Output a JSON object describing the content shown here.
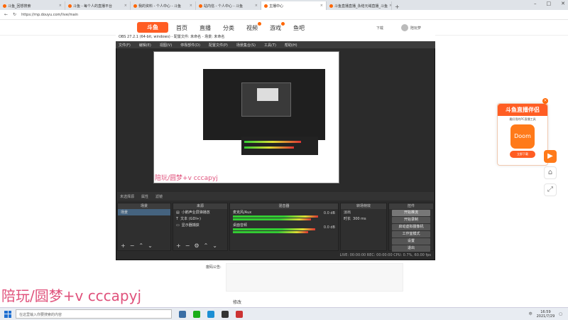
{
  "browser": {
    "tabs": [
      "斗鱼_回想搜索",
      "斗鱼 - 每个人的直播平台",
      "我的资料 - 个人中心 - 斗鱼",
      "站内信 - 个人中心 - 斗鱼",
      "主播中心",
      "斗鱼直播直播_永结元域直播_斗鱼"
    ],
    "active_tab": 4,
    "url": "https://mp.douyu.com/live/main"
  },
  "site": {
    "logo": "斗鱼",
    "nav": [
      "首页",
      "直播",
      "分类",
      "视频",
      "游戏",
      "鱼吧"
    ],
    "download": "下载",
    "user": "陪玩萝"
  },
  "obs": {
    "title": "OBS 27.2.1 (64-bit, windows) - 配置文件: 未命名 - 场景: 未命名",
    "menu": [
      "文件(F)",
      "编辑(E)",
      "视图(V)",
      "停靠部件(D)",
      "配置文件(P)",
      "场景集合(S)",
      "工具(T)",
      "帮助(H)"
    ],
    "no_source": "未选择源",
    "props": "属性",
    "filters": "滤镜",
    "scenes": {
      "header": "场景",
      "items": [
        "场景"
      ]
    },
    "sources": {
      "header": "来源",
      "items": [
        "小鹅声业屏弹播放",
        "文本 (GDI+)",
        "显示器捕获"
      ]
    },
    "mixer": {
      "header": "混音器",
      "ch1": "麦克风/Aux",
      "ch2": "桌面音频",
      "db": "0.0 dB"
    },
    "transitions": {
      "header": "转场特效",
      "type": "淡出",
      "dur_label": "时长",
      "dur": "300 ms"
    },
    "controls": {
      "header": "控件",
      "buttons": [
        "开始推流",
        "开始录制",
        "启动虚拟摄像机",
        "工作室模式",
        "设置",
        "退出"
      ]
    },
    "status": "LIVE: 00:00:00    REC: 00:00:00    CPU: 0.7%, 60.00 fps"
  },
  "watermark": "陪玩/圆梦+v cccapyj",
  "page": {
    "label": "废码公告:",
    "modify": "修改"
  },
  "ad": {
    "title": "斗鱼直播伴侣",
    "sub": "最好用的PC直播工具",
    "icon_text": "Doom",
    "button": "立即下载"
  },
  "taskbar": {
    "search": "在这里输入你要搜索的内容",
    "time": "16:59",
    "date": "2021/7/29",
    "lang": "中"
  }
}
